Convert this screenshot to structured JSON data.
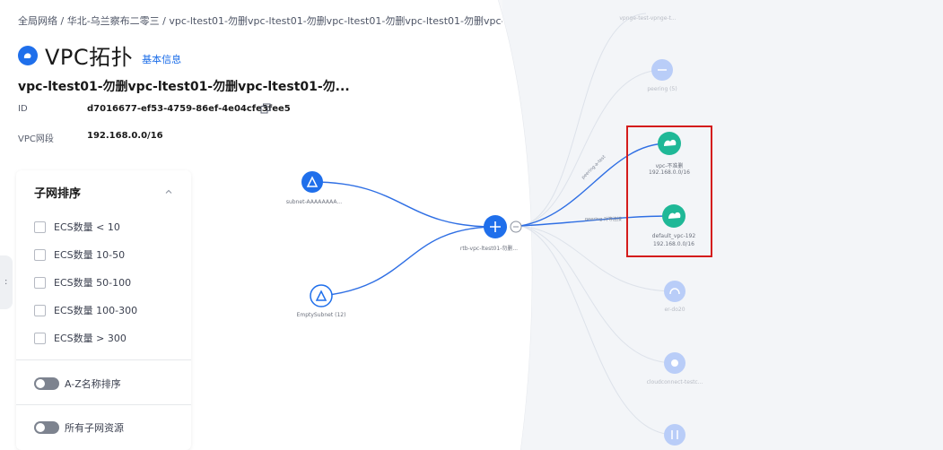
{
  "breadcrumb": "全局网络 / 华北-乌兰察布二零三 / vpc-ltest01-勿删vpc-ltest01-勿删vpc-ltest01-勿删vpc-ltest01-勿删vpc-ltes",
  "header": {
    "title": "VPC拓扑",
    "basic_info_link": "基本信息",
    "vpc_name": "vpc-ltest01-勿删vpc-ltest01-勿删vpc-ltest01-勿...",
    "id_label": "ID",
    "id_value": "d7016677-ef53-4759-86ef-4e04cfe3fee5",
    "cidr_label": "VPC网段",
    "cidr_value": "192.168.0.0/16"
  },
  "filter_panel": {
    "title": "子网排序",
    "options": [
      "ECS数量 < 10",
      "ECS数量 10-50",
      "ECS数量 50-100",
      "ECS数量 100-300",
      "ECS数量 > 300"
    ],
    "sort_toggle_label": "A-Z名称排序",
    "all_resources_toggle_label": "所有子网资源"
  },
  "side_handle_glyph": ":",
  "topology": {
    "subnet_a_label": "subnet-AAAAAAAA...",
    "empty_subnet_label": "EmptySubnet (12)",
    "route_table_label": "rtb-vpc-ltest01-勿删...",
    "top_partial_label": "vpnge-test-vpnge-t...",
    "peering_label": "peering (5)",
    "peer_vpc1_name": "vpc-不准删",
    "peer_vpc1_cidr": "192.168.0.0/16",
    "peer_vpc2_name": "default_vpc-192",
    "peer_vpc2_cidr": "192.168.0.0/16",
    "er_label": "er-do20",
    "cloudconnect_label": "cloudconnect-testc...",
    "edge_label_1": "peering-a-test",
    "edge_label_2": "peering-对等连接"
  },
  "colors": {
    "primary_blue": "#1f6feb",
    "peer_green": "#1fb897",
    "highlight_red": "#d41c1c"
  }
}
